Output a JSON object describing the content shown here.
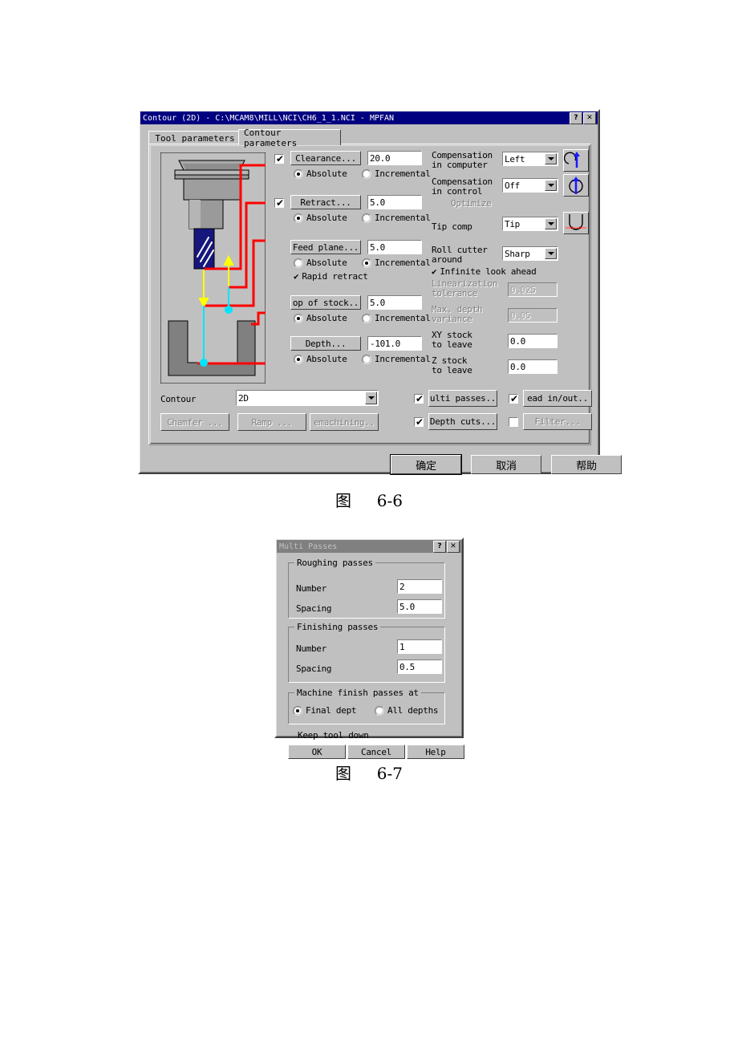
{
  "page": {
    "background": "#ffffff",
    "figure1_caption_cjk": "图",
    "figure1_caption_num": "6-6",
    "figure2_caption_cjk": "图",
    "figure2_caption_num": "6-7"
  },
  "colors": {
    "title_active": "#000080",
    "title_inactive": "#808080",
    "face": "#c0c0c0",
    "toolpath_red": "#ff0000",
    "toolpath_yellow": "#ffff00",
    "toolpath_cyan": "#00e5ff",
    "tool_blue": "#1a1a8c"
  },
  "dialog1": {
    "title": "Contour (2D) - C:\\MCAM8\\MILL\\NCI\\CH6_1_1.NCI - MPFAN",
    "help_button": "?",
    "close_button": "✕",
    "tabs": [
      {
        "label": "Tool parameters",
        "active": false
      },
      {
        "label": "Contour parameters",
        "active": true
      }
    ],
    "left_column": [
      {
        "checkbox": true,
        "checked": true,
        "button": "Clearance...",
        "value": "20.0",
        "mode": "Absolute",
        "radios": [
          "Absolute",
          "Incremental"
        ]
      },
      {
        "checkbox": true,
        "checked": true,
        "button": "Retract...",
        "value": "5.0",
        "mode": "Absolute",
        "radios": [
          "Absolute",
          "Incremental"
        ]
      },
      {
        "checkbox": false,
        "checked": false,
        "button": "Feed plane...",
        "value": "5.0",
        "mode": "Incremental",
        "radios": [
          "Absolute",
          "Incremental"
        ]
      },
      {
        "checkbox": false,
        "checked": false,
        "button": "op of stock..",
        "value": "5.0",
        "mode": "Absolute",
        "radios": [
          "Absolute",
          "Incremental"
        ]
      },
      {
        "checkbox": false,
        "checked": false,
        "button": "Depth...",
        "value": "-101.0",
        "mode": "Absolute",
        "radios": [
          "Absolute",
          "Incremental"
        ]
      }
    ],
    "rapid_retract": {
      "label": "Rapid retract",
      "checked": true
    },
    "right_column": {
      "comp_computer_label_1": "Compensation",
      "comp_computer_label_2": "in computer",
      "comp_computer_value": "Left",
      "comp_control_label_1": "Compensation",
      "comp_control_label_2": "in control",
      "comp_control_value": "Off",
      "optimize_label": "Optimize",
      "optimize_checked": false,
      "optimize_enabled": false,
      "tip_comp_label": "Tip comp",
      "tip_comp_value": "Tip",
      "roll_cutter_label_1": "Roll cutter",
      "roll_cutter_label_2": "around",
      "roll_cutter_value": "Sharp",
      "infinite_look_ahead_label": "Infinite look ahead",
      "infinite_look_ahead_checked": true,
      "lin_tol_label_1": "Linearization",
      "lin_tol_label_2": "tolerance",
      "lin_tol_value": "0.025",
      "lin_tol_enabled": false,
      "max_depth_label_1": "Max. depth",
      "max_depth_label_2": "variance",
      "max_depth_value": "0.05",
      "max_depth_enabled": false,
      "xy_stock_label_1": "XY stock",
      "xy_stock_label_2": "to leave",
      "xy_stock_value": "0.0",
      "z_stock_label_1": "Z stock",
      "z_stock_label_2": "to leave",
      "z_stock_value": "0.0"
    },
    "icons": [
      {
        "name": "arc-lead-in-icon"
      },
      {
        "name": "circle-lead-in-icon"
      },
      {
        "name": "tip-comp-icon"
      }
    ],
    "bottom": {
      "contour_label": "Contour",
      "contour_value": "2D",
      "chamfer_button": "Chamfer ...",
      "chamfer_enabled": false,
      "ramp_button": "Ramp ...",
      "ramp_enabled": false,
      "remachining_button": "emachining..",
      "remachining_enabled": false,
      "multi_passes_button": "ulti passes..",
      "multi_passes_checked": true,
      "lead_inout_button": "ead in/out..",
      "lead_inout_checked": true,
      "depth_cuts_button": "Depth cuts...",
      "depth_cuts_checked": true,
      "filter_button": "Filter...",
      "filter_checked": false,
      "filter_enabled": false
    },
    "footer": {
      "ok": "确定",
      "cancel": "取消",
      "help": "帮助"
    }
  },
  "dialog2": {
    "title": "Multi Passes",
    "help_button": "?",
    "close_button": "✕",
    "roughing": {
      "group_title": "Roughing passes",
      "number_label": "Number",
      "number_value": "2",
      "spacing_label": "Spacing",
      "spacing_value": "5.0"
    },
    "finishing": {
      "group_title": "Finishing passes",
      "number_label": "Number",
      "number_value": "1",
      "spacing_label": "Spacing",
      "spacing_value": "0.5"
    },
    "machine_finish": {
      "group_title": "Machine finish passes at",
      "options": [
        "Final dept",
        "All depths"
      ],
      "selected": "Final dept"
    },
    "keep_tool_down": {
      "label": "Keep tool down",
      "checked": false
    },
    "buttons": {
      "ok": "OK",
      "cancel": "Cancel",
      "help": "Help"
    }
  }
}
